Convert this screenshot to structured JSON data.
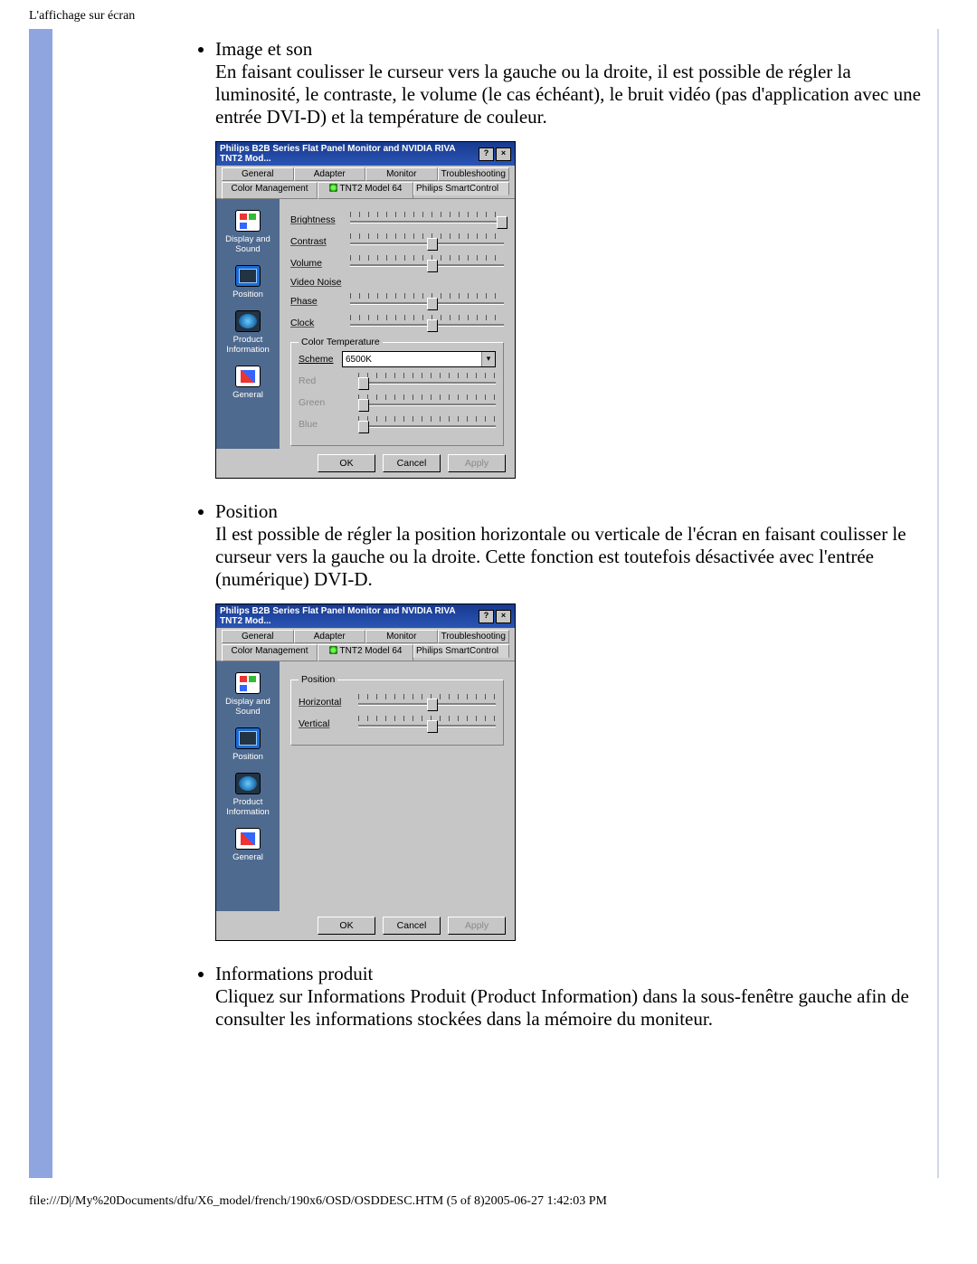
{
  "page_header": "L'affichage sur écran",
  "footer": "file:///D|/My%20Documents/dfu/X6_model/french/190x6/OSD/OSDDESC.HTM (5 of 8)2005-06-27 1:42:03 PM",
  "items": [
    {
      "title": "Image et son",
      "body": "En faisant coulisser le curseur vers la gauche ou la droite, il est possible de régler la luminosité, le contraste, le volume (le cas échéant), le bruit vidéo (pas d'application avec une entrée DVI-D) et la température de couleur."
    },
    {
      "title": "Position",
      "body": "Il est possible de régler la position horizontale ou verticale de l'écran en faisant coulisser le curseur vers la gauche ou la droite. Cette fonction est toutefois désactivée avec l'entrée (numérique) DVI-D."
    },
    {
      "title": "Informations produit",
      "body": "Cliquez sur Informations Produit (Product Information) dans la sous-fenêtre gauche afin de consulter les informations stockées dans la mémoire du moniteur."
    }
  ],
  "dialog": {
    "title": "Philips B2B Series Flat Panel Monitor and NVIDIA RIVA TNT2 Mod...",
    "help_btn": "?",
    "close_btn": "×",
    "tabs_top": [
      "General",
      "Adapter",
      "Monitor",
      "Troubleshooting"
    ],
    "tabs_bot": [
      "Color Management",
      "TNT2 Model 64",
      "Philips SmartControl"
    ],
    "side": [
      "Display and Sound",
      "Position",
      "Product Information",
      "General"
    ],
    "buttons": {
      "ok": "OK",
      "cancel": "Cancel",
      "apply": "Apply"
    }
  },
  "panel_ds": {
    "sliders": [
      "Brightness",
      "Contrast",
      "Volume",
      "Video Noise",
      "Phase",
      "Clock"
    ],
    "ct_legend": "Color Temperature",
    "scheme_label": "Scheme",
    "scheme_value": "6500K",
    "rgb": [
      "Red",
      "Green",
      "Blue"
    ]
  },
  "panel_pos": {
    "legend": "Position",
    "sliders": [
      "Horizontal",
      "Vertical"
    ]
  }
}
